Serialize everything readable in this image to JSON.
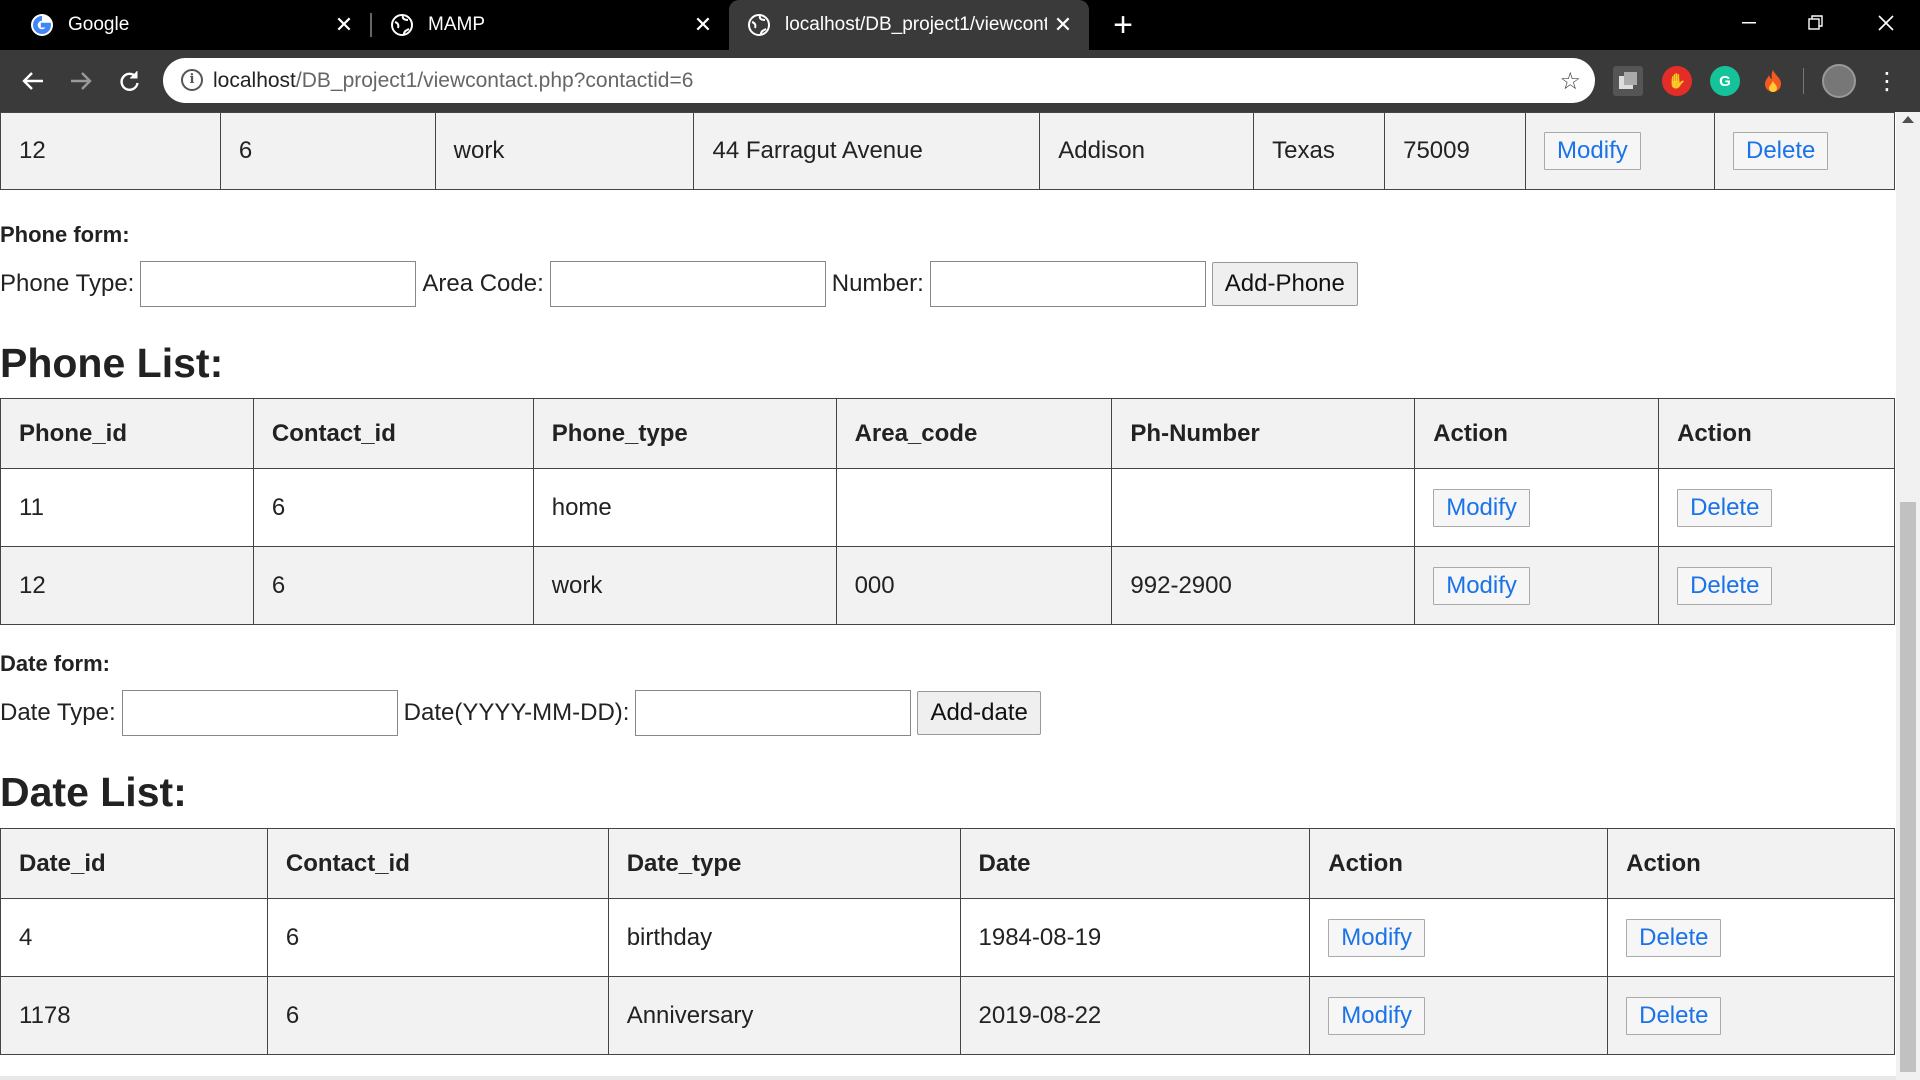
{
  "browser": {
    "tabs": [
      {
        "title": "Google",
        "icon": "google-icon"
      },
      {
        "title": "MAMP",
        "icon": "globe-icon"
      },
      {
        "title": "localhost/DB_project1/viewconta",
        "icon": "globe-icon"
      }
    ],
    "url_host": "localhost",
    "url_path": "/DB_project1/viewcontact.php?contactid=6"
  },
  "address_table": {
    "row": [
      "12",
      "6",
      "work",
      "44 Farragut Avenue",
      "Addison",
      "Texas",
      "75009"
    ],
    "modify_label": "Modify",
    "delete_label": "Delete"
  },
  "phone_form": {
    "title": "Phone form:",
    "type_label": "Phone Type:",
    "area_label": "Area Code:",
    "number_label": "Number:",
    "submit_label": "Add-Phone"
  },
  "phone_list": {
    "heading": "Phone List:",
    "headers": [
      "Phone_id",
      "Contact_id",
      "Phone_type",
      "Area_code",
      "Ph-Number",
      "Action",
      "Action"
    ],
    "rows": [
      [
        "11",
        "6",
        "home",
        "",
        ""
      ],
      [
        "12",
        "6",
        "work",
        "000",
        "992-2900"
      ]
    ],
    "modify_label": "Modify",
    "delete_label": "Delete"
  },
  "date_form": {
    "title": "Date form:",
    "type_label": "Date Type:",
    "date_label": "Date(YYYY-MM-DD):",
    "submit_label": "Add-date"
  },
  "date_list": {
    "heading": "Date List:",
    "headers": [
      "Date_id",
      "Contact_id",
      "Date_type",
      "Date",
      "Action",
      "Action"
    ],
    "rows": [
      [
        "4",
        "6",
        "birthday",
        "1984-08-19"
      ],
      [
        "1178",
        "6",
        "Anniversary",
        "2019-08-22"
      ]
    ],
    "modify_label": "Modify",
    "delete_label": "Delete"
  }
}
